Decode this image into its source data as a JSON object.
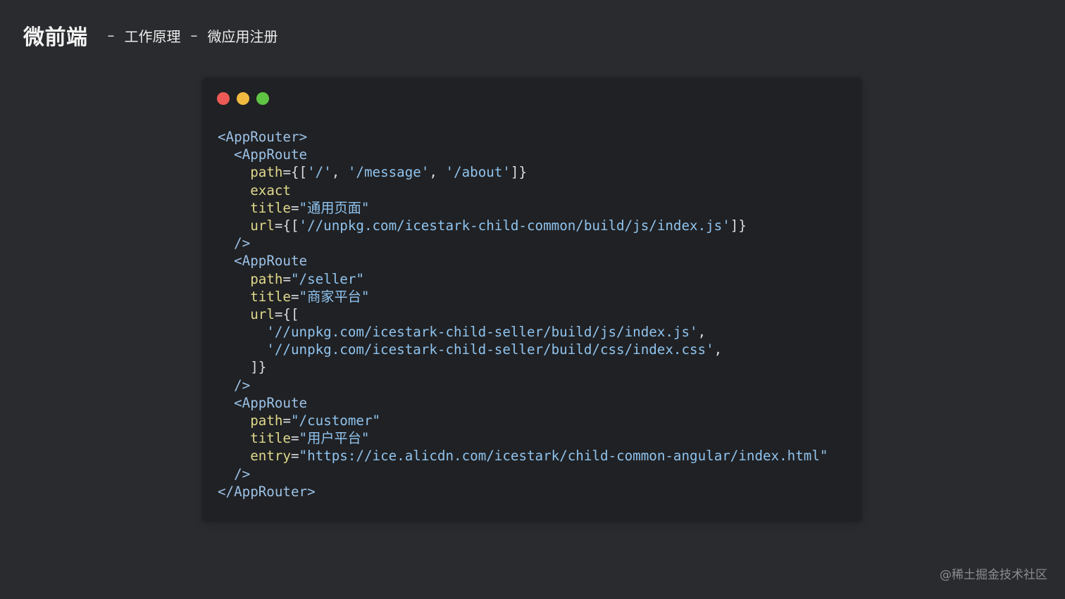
{
  "header": {
    "title": "微前端",
    "separator": "–",
    "crumb1": "工作原理",
    "crumb2": "微应用注册"
  },
  "window_controls": [
    "close-dot",
    "minimize-dot",
    "maximize-dot"
  ],
  "colors": {
    "background": "#2a2b2f",
    "code_background": "#202124",
    "dot_red": "#ed5a55",
    "dot_yellow": "#f2b940",
    "dot_green": "#5fc443",
    "tag": "#9cc2e7",
    "attr": "#dfd88b",
    "string": "#8fc3ee"
  },
  "code": {
    "l1_tag": "<AppRouter>",
    "l2_tag": "<AppRoute",
    "l3_attr": "path",
    "l3_eq": "={[",
    "l3_s1": "'/'",
    "l3_c1": ", ",
    "l3_s2": "'/message'",
    "l3_c2": ", ",
    "l3_s3": "'/about'",
    "l3_end": "]}",
    "l4_attr": "exact",
    "l5_attr": "title",
    "l5_eq": "=",
    "l5_str": "\"通用页面\"",
    "l6_attr": "url",
    "l6_eq": "={[",
    "l6_str": "'//unpkg.com/icestark-child-common/build/js/index.js'",
    "l6_end": "]}",
    "l7_tag": "/>",
    "l8_tag": "<AppRoute",
    "l9_attr": "path",
    "l9_eq": "=",
    "l9_str": "\"/seller\"",
    "l10_attr": "title",
    "l10_eq": "=",
    "l10_str": "\"商家平台\"",
    "l11_attr": "url",
    "l11_eq": "={[",
    "l12_str": "'//unpkg.com/icestark-child-seller/build/js/index.js'",
    "l12_end": ",",
    "l13_str": "'//unpkg.com/icestark-child-seller/build/css/index.css'",
    "l13_end": ",",
    "l14_end": "]}",
    "l15_tag": "/>",
    "l16_tag": "<AppRoute",
    "l17_attr": "path",
    "l17_eq": "=",
    "l17_str": "\"/customer\"",
    "l18_attr": "title",
    "l18_eq": "=",
    "l18_str": "\"用户平台\"",
    "l19_attr": "entry",
    "l19_eq": "=",
    "l19_str": "\"https://ice.alicdn.com/icestark/child-common-angular/index.html\"",
    "l20_tag": "/>",
    "l21_tag": "</AppRouter>"
  },
  "watermark": "@稀土掘金技术社区"
}
